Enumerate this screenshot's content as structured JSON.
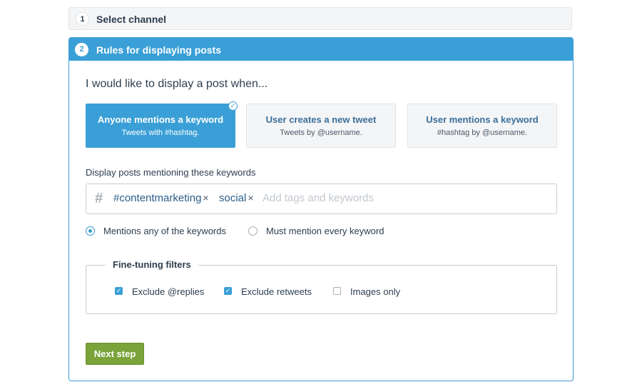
{
  "step1": {
    "number": "1",
    "title": "Select channel"
  },
  "step2": {
    "number": "2",
    "title": "Rules for displaying posts",
    "intro": "I would like to display a post when...",
    "options": [
      {
        "title": "Anyone mentions a keyword",
        "subtitle": "Tweets with #hashtag.",
        "selected": true
      },
      {
        "title": "User creates a new tweet",
        "subtitle": "Tweets by @username.",
        "selected": false
      },
      {
        "title": "User mentions a keyword",
        "subtitle": "#hashtag by @username.",
        "selected": false
      }
    ],
    "check_icon": "✓",
    "keywords_label": "Display posts mentioning these keywords",
    "keywords_input": {
      "icon": "#",
      "tags": [
        {
          "text": "#contentmarketing",
          "remove": "×"
        },
        {
          "text": "social",
          "remove": "×"
        }
      ],
      "placeholder": "Add tags and keywords"
    },
    "match_mode": [
      {
        "label": "Mentions any of the keywords",
        "checked": true
      },
      {
        "label": "Must mention every keyword",
        "checked": false
      }
    ],
    "filters": {
      "legend": "Fine-tuning filters",
      "checkmark": "✓",
      "items": [
        {
          "label": "Exclude @replies",
          "checked": true
        },
        {
          "label": "Exclude retweets",
          "checked": true
        },
        {
          "label": "Images only",
          "checked": false
        }
      ]
    },
    "next_button": "Next step"
  },
  "colors": {
    "accent": "#3a9fd6",
    "button": "#7aa33a",
    "panel": "#f4f5f6",
    "tag": "#2b5e89"
  }
}
